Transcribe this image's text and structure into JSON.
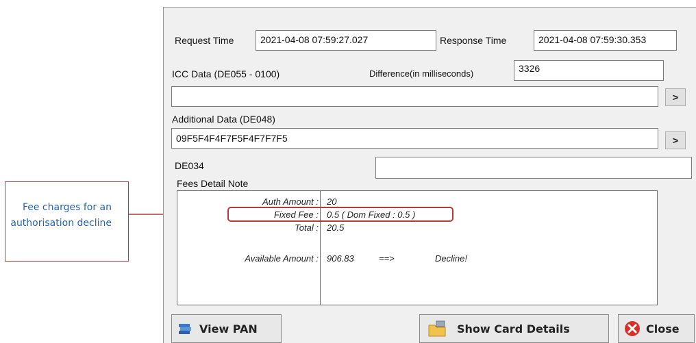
{
  "request": {
    "label": "Request Time",
    "value": "2021-04-08 07:59:27.027"
  },
  "response": {
    "label": "Response Time",
    "value": "2021-04-08 07:59:30.353"
  },
  "icc": {
    "label": "ICC Data (DE055 - 0100)",
    "value": ""
  },
  "difference": {
    "label": "Difference(in milliseconds)",
    "value": "3326"
  },
  "additional": {
    "label": "Additional Data (DE048)",
    "value": "09F5F4F4F7F5F4F7F7F5"
  },
  "de034": {
    "label": "DE034",
    "value": ""
  },
  "expand_label": ">",
  "fees": {
    "label": "Fees Detail Note",
    "auth_amount_label": "Auth Amount :",
    "auth_amount_value": "20",
    "fixed_fee_label": "Fixed Fee :",
    "fixed_fee_value": "0.5 ( Dom Fixed : 0.5 )",
    "total_label": "Total :",
    "total_value": "20.5",
    "available_label": "Available Amount :",
    "available_value": "906.83",
    "arrow": "==>",
    "decision": "Decline!"
  },
  "buttons": {
    "view_pan": "View PAN",
    "show_card_details": "Show Card Details",
    "close": "Close"
  },
  "callout": {
    "text": "Fee charges for an authorisation decline",
    "color": "#b33a3a",
    "text_color": "#2563ae"
  },
  "icons": [
    "view-pan-icon",
    "card-details-icon",
    "close-icon"
  ]
}
